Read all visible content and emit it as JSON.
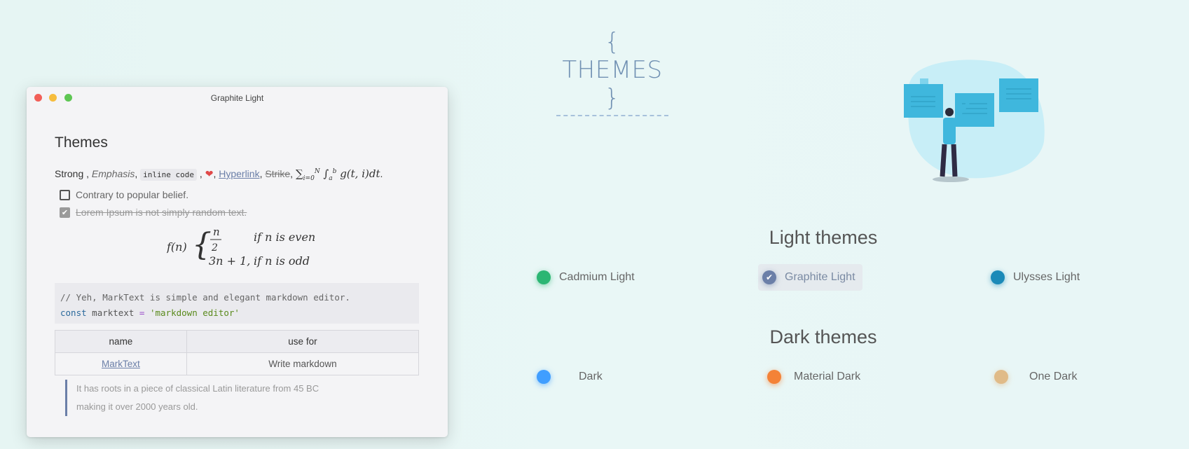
{
  "page": {
    "heading": "{ THEMES }"
  },
  "window": {
    "title": "Graphite Light",
    "heading": "Themes",
    "inline": {
      "strong": "Strong",
      "sep1": " ,",
      "emphasis": "Emphasis",
      "code": "inline code",
      "heart": "❤",
      "link": "Hyperlink",
      "strike": "Strike",
      "math": "∑ g(t, i)dt"
    },
    "tasks": [
      {
        "label": "Contrary to popular belief.",
        "checked": false
      },
      {
        "label": "Lorem Ipsum is not simply random text.",
        "checked": true
      }
    ],
    "math_block": {
      "lhs": "f(n)",
      "case1_expr": "n / 2",
      "case1_cond": "if n is even",
      "case2_expr": "3n + 1,",
      "case2_cond": "if n is odd"
    },
    "code": {
      "comment": "// Yeh, MarkText is simple and elegant markdown editor.",
      "keyword": "const",
      "identifier": "marktext",
      "operator": "=",
      "string": "'markdown editor'"
    },
    "table": {
      "headers": [
        "name",
        "use for"
      ],
      "rows": [
        [
          "MarkText",
          "Write markdown"
        ]
      ]
    },
    "quote": {
      "line1": "It has roots in a piece of classical Latin literature from 45 BC",
      "line2": "making it over 2000 years old."
    }
  },
  "light_themes": {
    "title": "Light themes",
    "items": [
      {
        "label": "Cadmium Light",
        "color": "#2bb673",
        "selected": false
      },
      {
        "label": "Graphite Light",
        "color": "#6b7fa8",
        "selected": true
      },
      {
        "label": "Ulysses Light",
        "color": "#1b8ab8",
        "selected": false
      }
    ]
  },
  "dark_themes": {
    "title": "Dark themes",
    "items": [
      {
        "label": "Dark",
        "color": "#409eff",
        "selected": false
      },
      {
        "label": "Material Dark",
        "color": "#f48237",
        "selected": false
      },
      {
        "label": "One Dark",
        "color": "#e0bb88",
        "selected": false
      }
    ]
  }
}
